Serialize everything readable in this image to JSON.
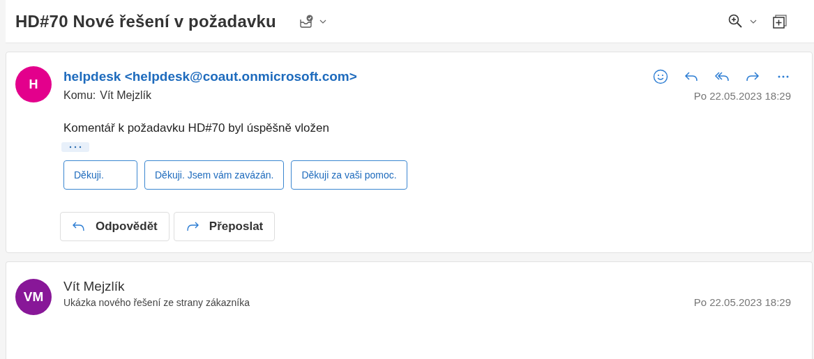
{
  "subject": "HD#70 Nové řešení v požadavku",
  "messages": [
    {
      "kind": "expanded",
      "initials": "H",
      "color": "#e3008c",
      "sender": "helpdesk <helpdesk@coaut.onmicrosoft.com>",
      "to_label": "Komu:",
      "to": "Vít Mejzlík",
      "date": "Po 22.05.2023 18:29",
      "body": "Komentář k požadavku HD#70 byl úspěšně vložen",
      "quick_replies": [
        "Děkuji.",
        "Děkuji. Jsem vám zavázán.",
        "Děkuji za vaši pomoc."
      ],
      "actions": [
        {
          "kind": "reply",
          "label": "Odpovědět"
        },
        {
          "kind": "forward",
          "label": "Přeposlat"
        }
      ]
    },
    {
      "kind": "collapsed",
      "initials": "VM",
      "color": "#881798",
      "sender": "Vít Mejzlík",
      "preview": "Ukázka nového řešení ze strany zákazníka",
      "date": "Po 22.05.2023 18:29"
    }
  ]
}
